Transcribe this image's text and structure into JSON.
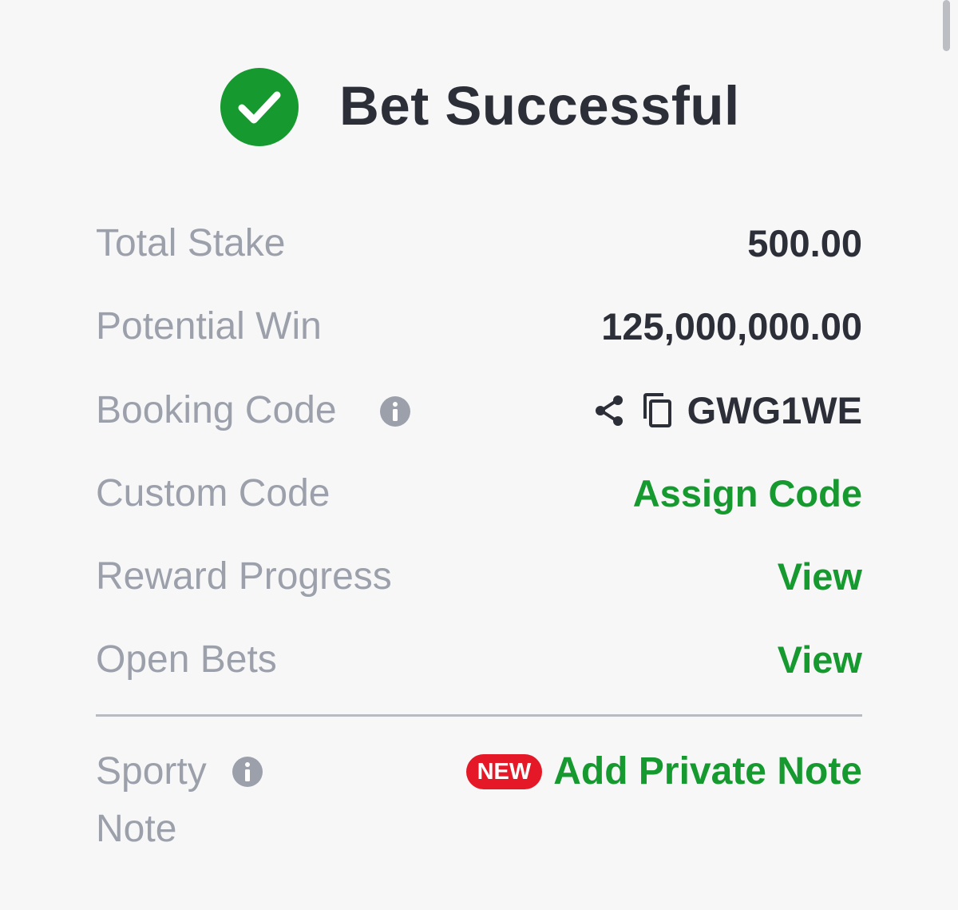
{
  "colors": {
    "background": "#f7f7f8",
    "success_green": "#16992f",
    "label_gray": "#9ca0ab",
    "value_dark": "#2c2f38",
    "badge_red": "#e41827"
  },
  "header": {
    "icon": "check-circle-icon",
    "title": "Bet Successful"
  },
  "summary": {
    "total_stake": {
      "label": "Total Stake",
      "value": "500.00"
    },
    "potential_win": {
      "label": "Potential Win",
      "value": "125,000,000.00"
    },
    "booking_code": {
      "label": "Booking Code",
      "info_icon": "info-icon",
      "share_icon": "share-icon",
      "copy_icon": "copy-icon",
      "value": "GWG1WE"
    },
    "custom_code": {
      "label": "Custom Code",
      "action": "Assign Code"
    },
    "reward_progress": {
      "label": "Reward Progress",
      "action": "View"
    },
    "open_bets": {
      "label": "Open Bets",
      "action": "View"
    }
  },
  "note": {
    "label_line1": "Sporty",
    "label_line2": "Note",
    "info_icon": "info-icon",
    "badge": "NEW",
    "action": "Add Private Note"
  }
}
